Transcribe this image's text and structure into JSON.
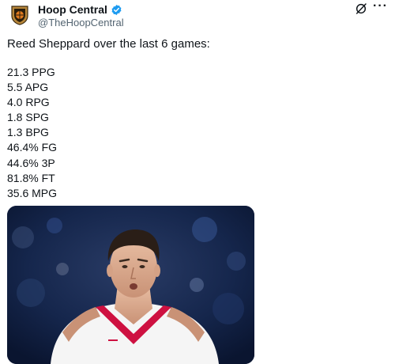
{
  "author": {
    "display_name": "Hoop Central",
    "handle": "@TheHoopCentral"
  },
  "tweet": {
    "text": "Reed Sheppard over the last 6 games:",
    "stats": [
      "21.3 PPG",
      "5.5 APG",
      "4.0 RPG",
      "1.8 SPG",
      "1.3 BPG",
      "46.4% FG",
      "44.6% 3P",
      "81.8% FT",
      "35.6 MPG"
    ]
  },
  "icons": {
    "verified": "verified-badge-icon",
    "grok": "grok-icon",
    "more": "more-options-icon"
  },
  "colors": {
    "verified": "#1d9bf0",
    "handle_text": "#536471",
    "jersey_trim": "#ce1141"
  }
}
